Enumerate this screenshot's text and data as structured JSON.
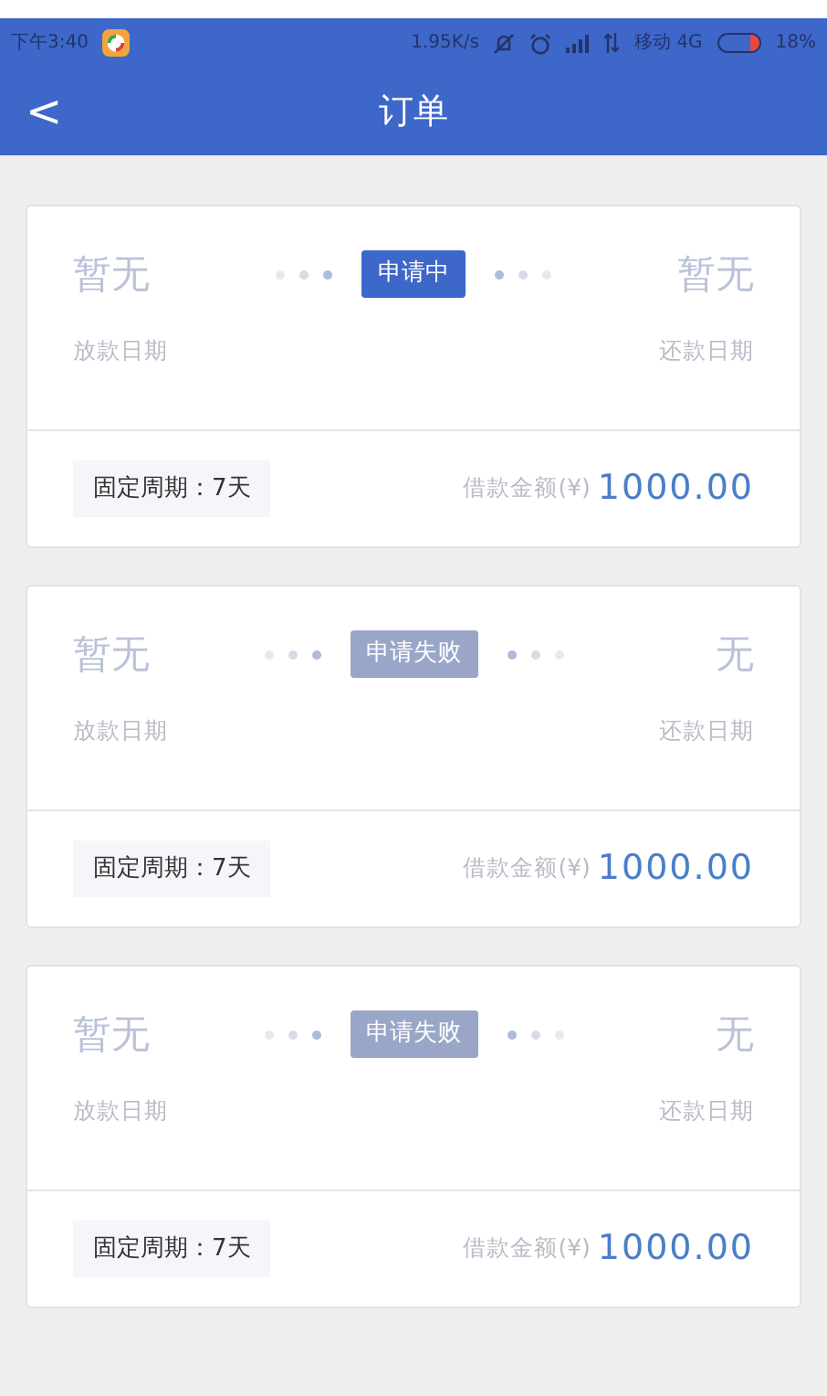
{
  "status_bar": {
    "time": "下午3:40",
    "speed": "1.95K/s",
    "carrier": "移动 4G",
    "battery": "18%"
  },
  "header": {
    "back": "<",
    "title": "订单"
  },
  "orders": [
    {
      "loan_date": "暂无",
      "loan_date_label": "放款日期",
      "status": "申请中",
      "color": "#3d67c9",
      "repay_date": "暂无",
      "repay_date_label": "还款日期",
      "period": "固定周期：7天",
      "amount_label": "借款金额(¥)",
      "amount": "1000.00"
    },
    {
      "loan_date": "暂无",
      "loan_date_label": "放款日期",
      "status": "申请失败",
      "color": "#9aa6c7",
      "repay_date": "无",
      "repay_date_label": "还款日期",
      "period": "固定周期：7天",
      "amount_label": "借款金额(¥)",
      "amount": "1000.00"
    },
    {
      "loan_date": "暂无",
      "loan_date_label": "放款日期",
      "status": "申请失败",
      "color": "#9aa6c7",
      "repay_date": "无",
      "repay_date_label": "还款日期",
      "period": "固定周期：7天",
      "amount_label": "借款金额(¥)",
      "amount": "1000.00"
    }
  ]
}
